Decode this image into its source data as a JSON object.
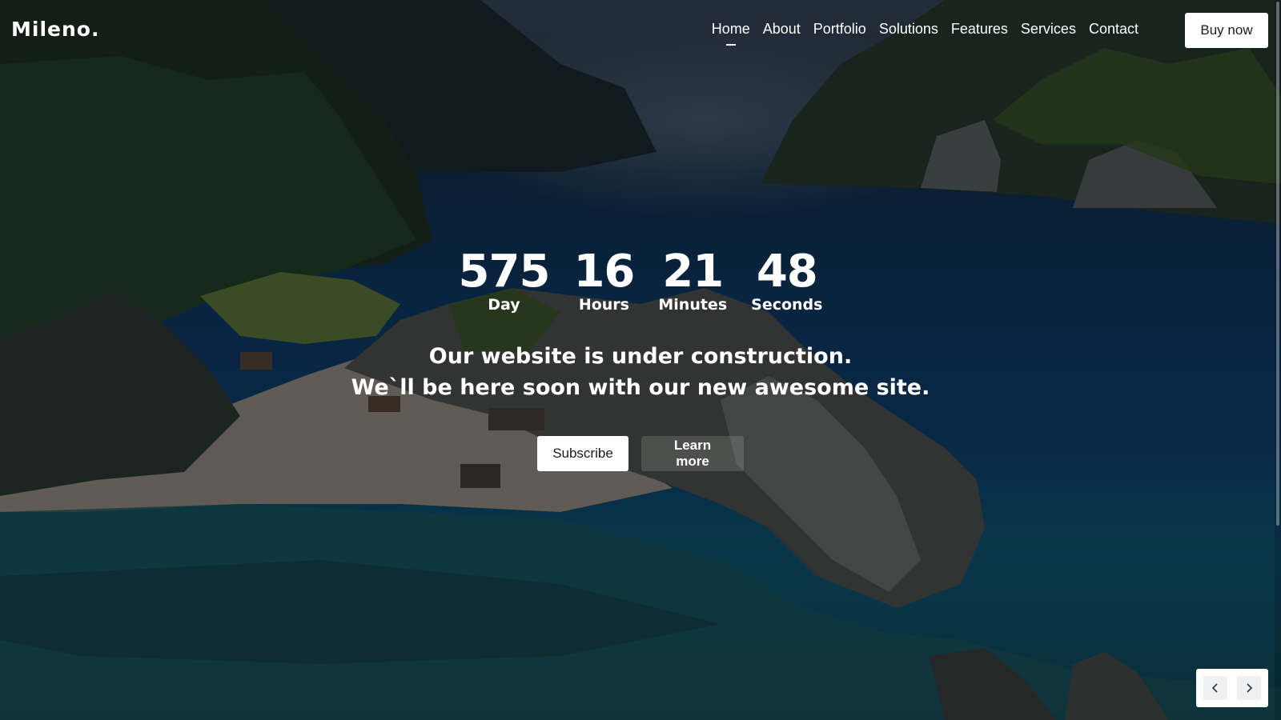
{
  "brand": {
    "logo": "Mileno."
  },
  "nav": {
    "items": [
      {
        "label": "Home",
        "active": true
      },
      {
        "label": "About",
        "active": false
      },
      {
        "label": "Portfolio",
        "active": false
      },
      {
        "label": "Solutions",
        "active": false
      },
      {
        "label": "Features",
        "active": false
      },
      {
        "label": "Services",
        "active": false
      },
      {
        "label": "Contact",
        "active": false
      }
    ],
    "buy_label": "Buy now"
  },
  "countdown": {
    "days": {
      "value": "575",
      "label": "Day"
    },
    "hours": {
      "value": "16",
      "label": "Hours"
    },
    "minutes": {
      "value": "21",
      "label": "Minutes"
    },
    "seconds": {
      "value": "48",
      "label": "Seconds"
    }
  },
  "hero": {
    "line1": "Our website is under construction.",
    "line2": "We`ll be here soon with our new awesome site.",
    "subscribe_label": "Subscribe",
    "learn_more_label": "Learn more"
  },
  "slider": {
    "prev_icon": "chevron-left-icon",
    "next_icon": "chevron-right-icon"
  },
  "colors": {
    "text": "#ffffff",
    "button_bg": "#ffffff",
    "button_text": "#1a1a1a"
  }
}
